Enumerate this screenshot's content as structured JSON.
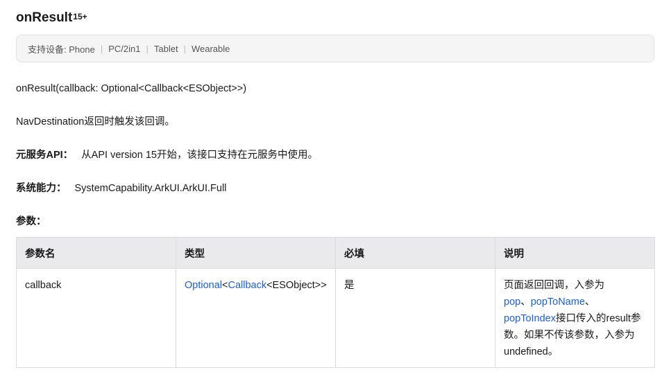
{
  "heading": {
    "title": "onResult",
    "sup": "15+"
  },
  "devices": {
    "label": "支持设备: Phone",
    "items": [
      "PC/2in1",
      "Tablet",
      "Wearable"
    ]
  },
  "signature": "onResult(callback: Optional<Callback<ESObject>>)",
  "description": "NavDestination返回时触发该回调。",
  "meta": {
    "atomic_label": "元服务API：",
    "atomic_value": "从API version 15开始，该接口支持在元服务中使用。",
    "syscap_label": "系统能力：",
    "syscap_value": "SystemCapability.ArkUI.ArkUI.Full"
  },
  "params_label": "参数：",
  "table": {
    "headers": [
      "参数名",
      "类型",
      "必填",
      "说明"
    ],
    "rows": [
      {
        "name": "callback",
        "type": {
          "link1": "Optional",
          "lt1": "<",
          "link2": "Callback",
          "rest": "<ESObject>>"
        },
        "required": "是",
        "desc": {
          "part1": "页面返回回调，入参为",
          "link_pop": "pop",
          "sep1": "、",
          "link_popToName": "popToName",
          "sep2": "、",
          "link_popToIndex": "popToIndex",
          "part2": "接口传入的result参数。如果不传该参数，入参为undefined。"
        }
      }
    ]
  }
}
